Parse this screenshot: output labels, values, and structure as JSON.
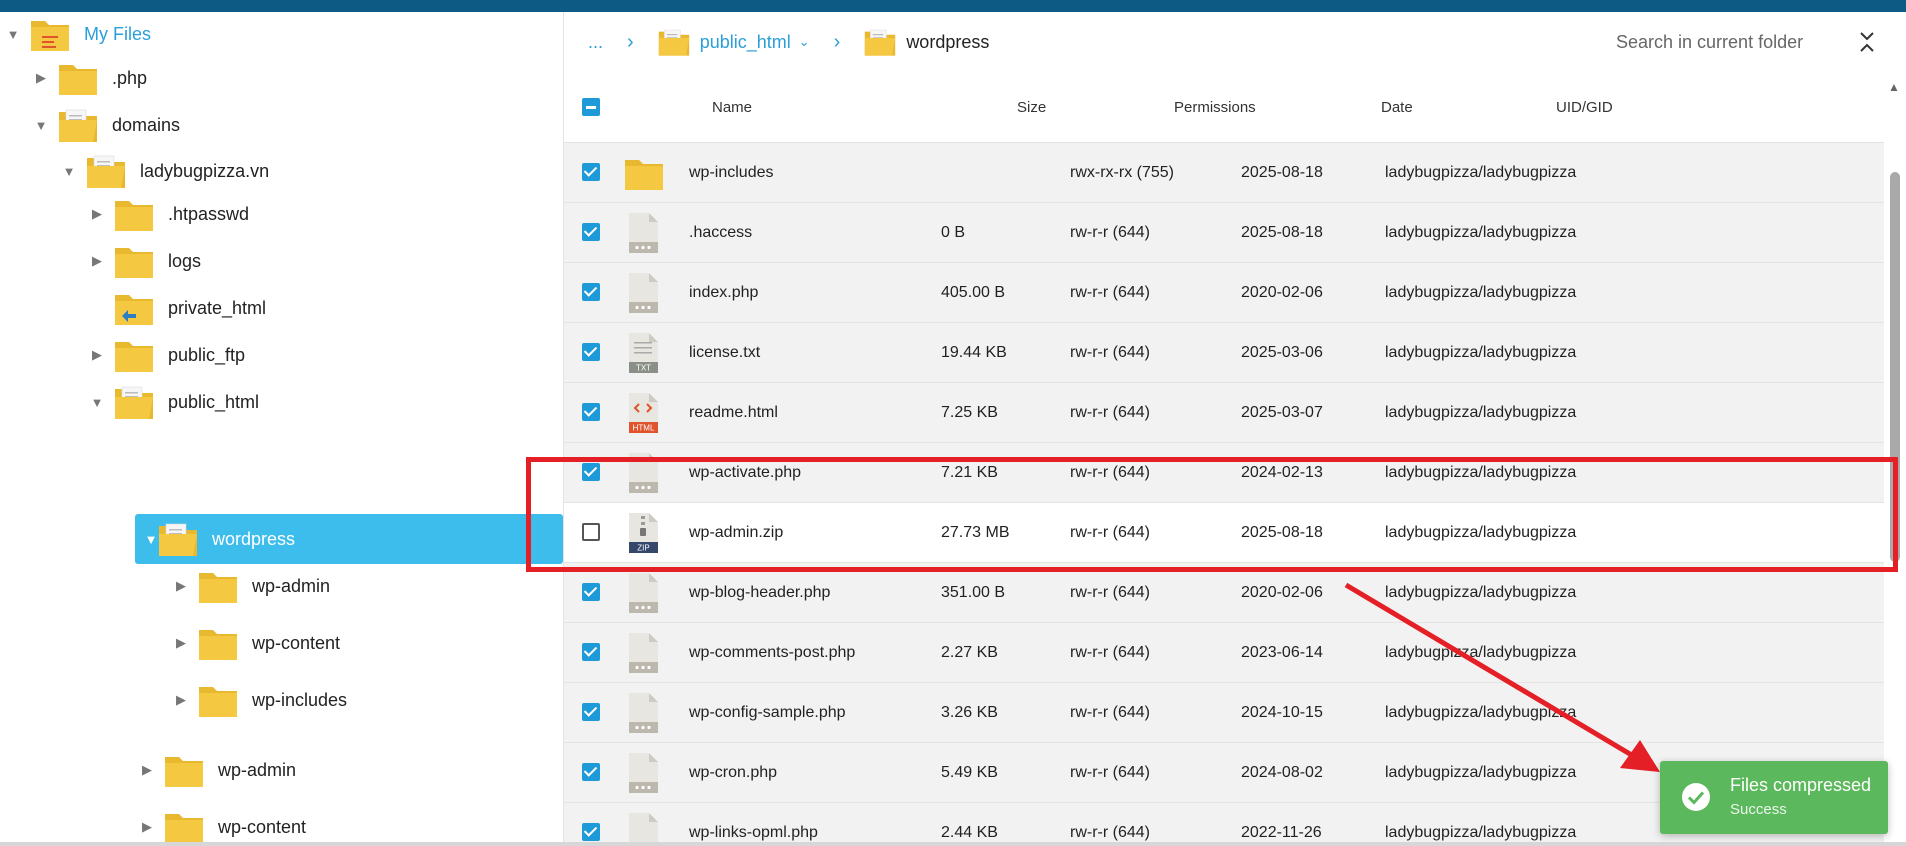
{
  "tree": {
    "root": "My Files",
    "nodes": [
      {
        "label": ".php"
      },
      {
        "label": "domains"
      },
      {
        "label": "ladybugpizza.vn"
      },
      {
        "label": ".htpasswd"
      },
      {
        "label": "logs"
      },
      {
        "label": "private_html"
      },
      {
        "label": "public_ftp"
      },
      {
        "label": "public_html"
      },
      {
        "label": "wordpress"
      },
      {
        "label": "wp-admin"
      },
      {
        "label": "wp-content"
      },
      {
        "label": "wp-includes"
      },
      {
        "label": "wp-admin"
      },
      {
        "label": "wp-content"
      }
    ]
  },
  "breadcrumb": {
    "ellipsis": "...",
    "parent": "public_html",
    "current": "wordpress"
  },
  "search": {
    "placeholder": "Search in current folder"
  },
  "table": {
    "headers": {
      "name": "Name",
      "size": "Size",
      "permissions": "Permissions",
      "date": "Date",
      "uid": "UID/GID"
    },
    "rows": [
      {
        "name": "wp-includes",
        "size": "",
        "perm": "rwx-rx-rx (755)",
        "date": "2025-08-18",
        "uid": "ladybugpizza/ladybugpizza",
        "icon": "folder-icon",
        "checked": true
      },
      {
        "name": ".haccess",
        "size": "0 B",
        "perm": "rw-r-r (644)",
        "date": "2025-08-18",
        "uid": "ladybugpizza/ladybugpizza",
        "icon": "file-icon",
        "checked": true
      },
      {
        "name": "index.php",
        "size": "405.00 B",
        "perm": "rw-r-r (644)",
        "date": "2020-02-06",
        "uid": "ladybugpizza/ladybugpizza",
        "icon": "file-icon",
        "checked": true
      },
      {
        "name": "license.txt",
        "size": "19.44 KB",
        "perm": "rw-r-r (644)",
        "date": "2025-03-06",
        "uid": "ladybugpizza/ladybugpizza",
        "icon": "txt-file-icon",
        "checked": true
      },
      {
        "name": "readme.html",
        "size": "7.25 KB",
        "perm": "rw-r-r (644)",
        "date": "2025-03-07",
        "uid": "ladybugpizza/ladybugpizza",
        "icon": "html-file-icon",
        "checked": true
      },
      {
        "name": "wp-activate.php",
        "size": "7.21 KB",
        "perm": "rw-r-r (644)",
        "date": "2024-02-13",
        "uid": "ladybugpizza/ladybugpizza",
        "icon": "file-icon",
        "checked": true
      },
      {
        "name": "wp-admin.zip",
        "size": "27.73 MB",
        "perm": "rw-r-r (644)",
        "date": "2025-08-18",
        "uid": "ladybugpizza/ladybugpizza",
        "icon": "zip-file-icon",
        "checked": false
      },
      {
        "name": "wp-blog-header.php",
        "size": "351.00 B",
        "perm": "rw-r-r (644)",
        "date": "2020-02-06",
        "uid": "ladybugpizza/ladybugpizza",
        "icon": "file-icon",
        "checked": true
      },
      {
        "name": "wp-comments-post.php",
        "size": "2.27 KB",
        "perm": "rw-r-r (644)",
        "date": "2023-06-14",
        "uid": "ladybugpizza/ladybugpizza",
        "icon": "file-icon",
        "checked": true
      },
      {
        "name": "wp-config-sample.php",
        "size": "3.26 KB",
        "perm": "rw-r-r (644)",
        "date": "2024-10-15",
        "uid": "ladybugpizza/ladybugpizza",
        "icon": "file-icon",
        "checked": true
      },
      {
        "name": "wp-cron.php",
        "size": "5.49 KB",
        "perm": "rw-r-r (644)",
        "date": "2024-08-02",
        "uid": "ladybugpizza/ladybugpizza",
        "icon": "file-icon",
        "checked": true
      },
      {
        "name": "wp-links-opml.php",
        "size": "2.44 KB",
        "perm": "rw-r-r (644)",
        "date": "2022-11-26",
        "uid": "ladybugpizza/ladybugpizza",
        "icon": "file-icon",
        "checked": true
      }
    ]
  },
  "file_badges": {
    "txt": "TXT",
    "html": "HTML",
    "zip": "ZIP"
  },
  "toast": {
    "title": "Files compressed",
    "subtitle": "Success"
  },
  "colors": {
    "accent": "#3dbdec",
    "link": "#2a9fd8",
    "topbar": "#0d5b85",
    "highlight": "#e41f26",
    "toast": "#5cb85c"
  }
}
